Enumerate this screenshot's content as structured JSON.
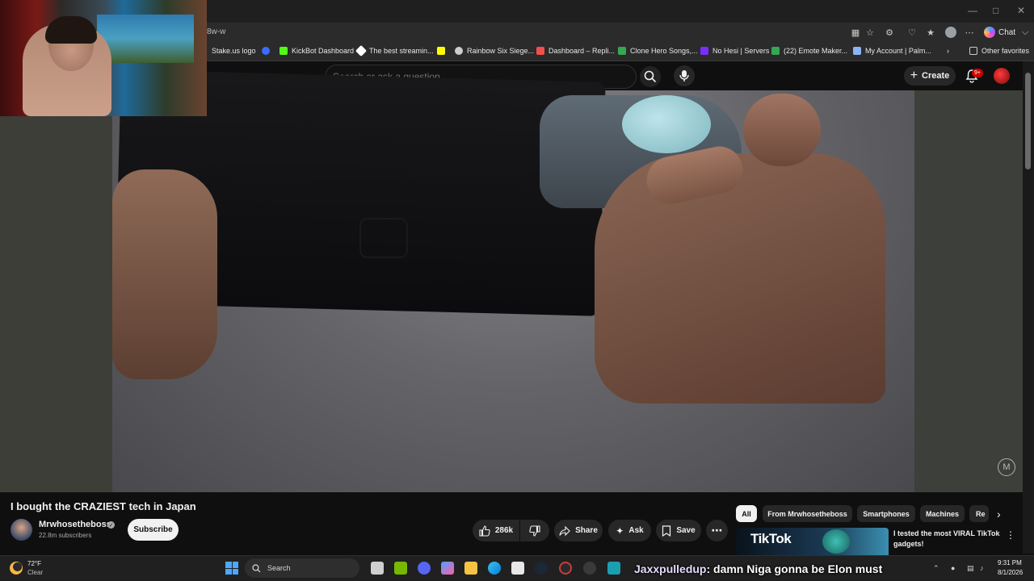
{
  "browser": {
    "url_fragment": "8w-w",
    "copilot_label": "Chat",
    "other_favorites": "Other favorites",
    "bookmarks": [
      {
        "label": "Stake.us logo",
        "color": "#1a2c38"
      },
      {
        "label": "",
        "color": "#3b6cff"
      },
      {
        "label": "KickBot Dashboard",
        "color": "#53fc18"
      },
      {
        "label": "The best streamin...",
        "color": "#ffffff"
      },
      {
        "label": "",
        "color": "#fffc00"
      },
      {
        "label": "Rainbow Six Siege...",
        "color": "#cccccc"
      },
      {
        "label": "Dashboard – Repli...",
        "color": "#f24e4e"
      },
      {
        "label": "Clone Hero Songs,...",
        "color": "#34a853"
      },
      {
        "label": "No Hesi | Servers",
        "color": "#7b2cff"
      },
      {
        "label": "(22) Emote Maker...",
        "color": "#34a853"
      },
      {
        "label": "My Account | Palm...",
        "color": "#8ab4f8"
      }
    ]
  },
  "youtube": {
    "search_placeholder": "Search or ask a question",
    "create_label": "Create",
    "notification_count": "9+",
    "video_title": "I bought the CRAZIEST tech in Japan",
    "channel": {
      "name": "Mrwhosetheboss",
      "subscribers": "22.8m subscribers"
    },
    "subscribe_label": "Subscribe",
    "actions": {
      "likes": "286k",
      "share": "Share",
      "ask": "Ask",
      "save": "Save"
    },
    "chips": [
      "All",
      "From Mrwhosetheboss",
      "Smartphones",
      "Machines",
      "Re"
    ],
    "recommendation": {
      "thumbnail_text": "TikTok",
      "title": "I tested the most VIRAL TikTok gadgets!"
    }
  },
  "taskbar": {
    "weather_temp": "72°F",
    "weather_condition": "Clear",
    "search_label": "Search",
    "time": "9:31 PM",
    "date": "8/1/2026"
  },
  "stream_overlay": {
    "chat_user": "Jaxxpulledup",
    "chat_message": ": damn Niga gonna be Elon must"
  }
}
